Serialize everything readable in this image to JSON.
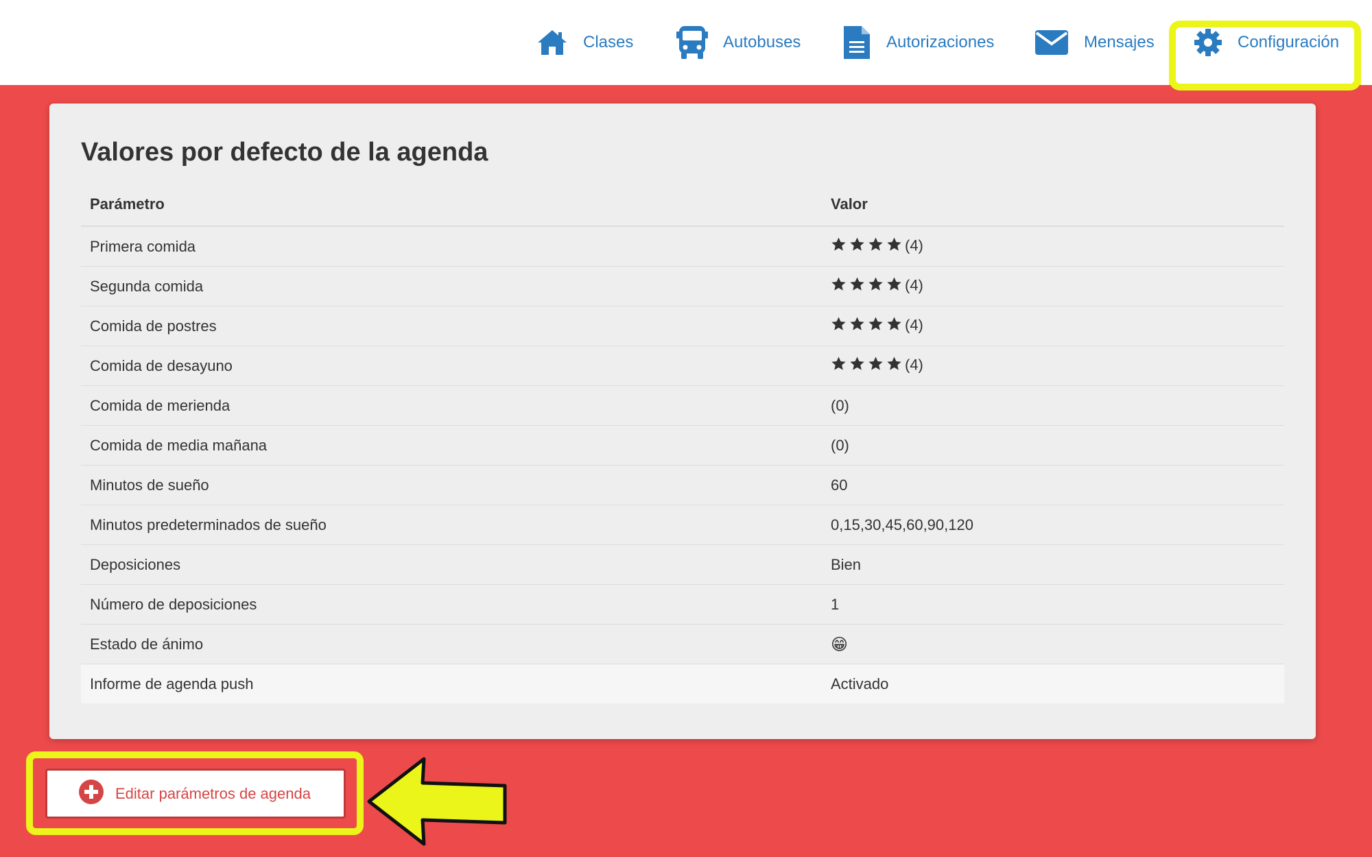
{
  "nav": {
    "items": [
      {
        "label": "Clases",
        "icon": "home-icon"
      },
      {
        "label": "Autobuses",
        "icon": "bus-icon"
      },
      {
        "label": "Autorizaciones",
        "icon": "document-icon"
      },
      {
        "label": "Mensajes",
        "icon": "envelope-icon"
      },
      {
        "label": "Configuración",
        "icon": "gear-icon",
        "highlighted": true
      }
    ],
    "color": "#2a7bc0"
  },
  "panel": {
    "title": "Valores por defecto de la agenda",
    "columns": [
      "Parámetro",
      "Valor"
    ],
    "rows": [
      {
        "param": "Primera comida",
        "value": "(4)",
        "stars": 4
      },
      {
        "param": "Segunda comida",
        "value": "(4)",
        "stars": 4
      },
      {
        "param": "Comida de postres",
        "value": "(4)",
        "stars": 4
      },
      {
        "param": "Comida de desayuno",
        "value": "(4)",
        "stars": 4
      },
      {
        "param": "Comida de merienda",
        "value": "(0)",
        "stars": 0
      },
      {
        "param": "Comida de media mañana",
        "value": "(0)",
        "stars": 0
      },
      {
        "param": "Minutos de sueño",
        "value": "60"
      },
      {
        "param": "Minutos predeterminados de sueño",
        "value": "0,15,30,45,60,90,120"
      },
      {
        "param": "Deposiciones",
        "value": "Bien"
      },
      {
        "param": "Número de deposiciones",
        "value": "1"
      },
      {
        "param": "Estado de ánimo",
        "value": "😁"
      },
      {
        "param": "Informe de agenda push",
        "value": "Activado"
      }
    ]
  },
  "actions": {
    "edit_label": "Editar parámetros de agenda"
  },
  "colors": {
    "background": "#ed4b4b",
    "highlight": "#ecf51a",
    "button_text": "#d64545"
  }
}
